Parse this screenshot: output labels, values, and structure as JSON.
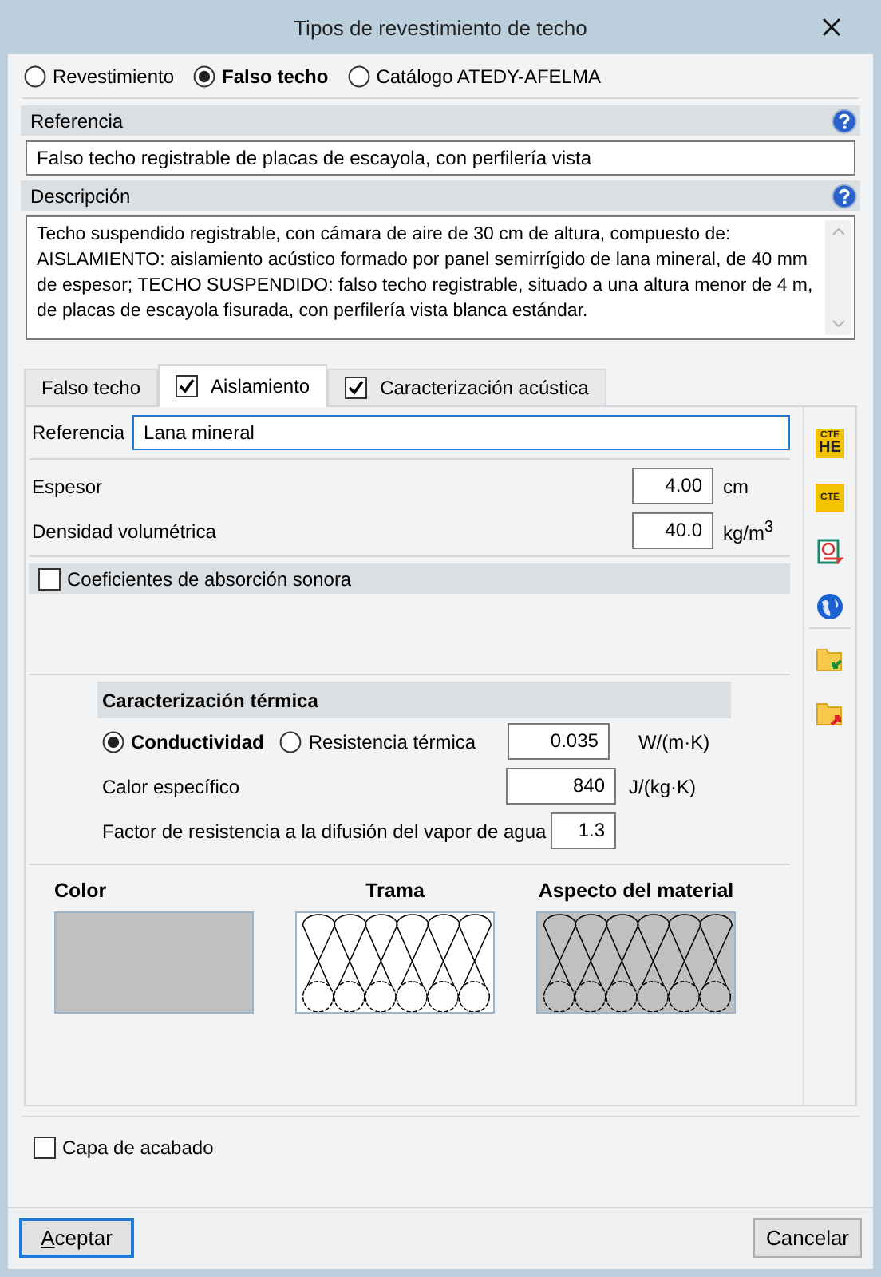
{
  "window": {
    "title": "Tipos de revestimiento de techo"
  },
  "type_options": [
    {
      "label": "Revestimiento",
      "selected": false
    },
    {
      "label": "Falso techo",
      "selected": true
    },
    {
      "label": "Catálogo ATEDY-AFELMA",
      "selected": false
    }
  ],
  "reference": {
    "label": "Referencia",
    "value": "Falso techo registrable de placas de escayola, con perfilería vista"
  },
  "description": {
    "label": "Descripción",
    "value": "Techo suspendido registrable, con cámara de aire de 30 cm de altura, compuesto de: AISLAMIENTO: aislamiento acústico formado por panel semirrígido de lana mineral, de 40 mm de espesor; TECHO SUSPENDIDO: falso techo registrable, situado a una altura menor de 4 m, de placas de escayola fisurada, con perfilería vista blanca estándar."
  },
  "tabs": [
    {
      "kind": "plain",
      "label": "Falso techo",
      "selected": false
    },
    {
      "kind": "check",
      "label": "Aislamiento",
      "selected": true,
      "checked": true
    },
    {
      "kind": "check",
      "label": "Caracterización acústica",
      "selected": false,
      "checked": true
    }
  ],
  "insulation": {
    "reference": {
      "label": "Referencia",
      "value": "Lana mineral"
    },
    "properties": [
      {
        "label": "Espesor",
        "value": "4.00",
        "unit": "cm"
      },
      {
        "label": "Densidad volumétrica",
        "value": "40.0",
        "unit": "kg/m$^{3}$"
      }
    ],
    "absorption": {
      "label": "Coeficientes de absorción sonora",
      "checked": false
    },
    "thermal": {
      "title": "Caracterización térmica",
      "modes": [
        {
          "label": "Conductividad",
          "selected": true
        },
        {
          "label": "Resistencia térmica",
          "selected": false
        }
      ],
      "mode_value": {
        "value": "0.035",
        "unit": "W/(m·K)"
      },
      "rows": [
        {
          "label": "Calor específico",
          "value": "840",
          "unit": "J/(kg·K)"
        },
        {
          "label": "Factor de resistencia a la difusión del vapor de agua",
          "value": "1.3"
        }
      ]
    },
    "appearance": [
      {
        "kind": "color",
        "label": "Color",
        "color": "#c0c0c0"
      },
      {
        "kind": "pattern",
        "label": "Trama"
      },
      {
        "kind": "material",
        "label": "Aspecto del material"
      }
    ]
  },
  "tools": [
    {
      "kind": "badge",
      "label": "CTE",
      "sub": "HE"
    },
    {
      "kind": "badge",
      "label": "CTE"
    },
    {
      "kind": "certificate"
    },
    {
      "kind": "globe"
    },
    {
      "kind": "folder-import"
    },
    {
      "kind": "folder-export"
    }
  ],
  "finish_layer": {
    "label": "Capa de acabado",
    "checked": false
  },
  "buttons": [
    {
      "label": "Aceptar",
      "default": true
    },
    {
      "label": "Cancelar",
      "default": false
    }
  ]
}
